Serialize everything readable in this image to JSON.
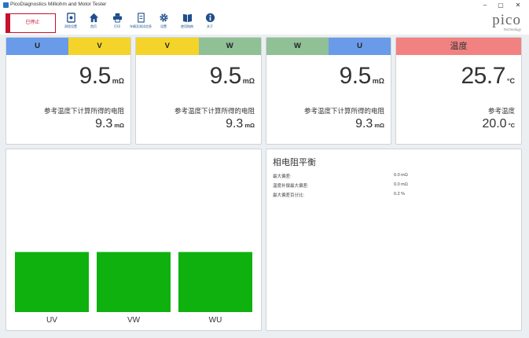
{
  "window": {
    "title": "PicoDiagnostics Milliohm and Motor Tester",
    "minimize": "–",
    "maximize": "▢",
    "close": "✕"
  },
  "toolbar": {
    "stop_label": "已停止",
    "tools": [
      {
        "icon": "sensor-settings-icon",
        "label": "测验设置"
      },
      {
        "icon": "home-icon",
        "label": "首页"
      },
      {
        "icon": "print-icon",
        "label": "打印"
      },
      {
        "icon": "report-icon",
        "label": "车辆及测试信息"
      },
      {
        "icon": "gear-icon",
        "label": "设置"
      },
      {
        "icon": "book-icon",
        "label": "使用指南"
      },
      {
        "icon": "info-icon",
        "label": "关于"
      }
    ],
    "logo_text": "pico",
    "logo_sub": "Technology"
  },
  "colors": {
    "U": "#6a9be8",
    "V": "#f4d42a",
    "W": "#90c095",
    "temp": "#f28282",
    "bar": "#0fb10f"
  },
  "cards": [
    {
      "head": [
        {
          "text": "U",
          "color": "#6a9be8"
        },
        {
          "text": "V",
          "color": "#f4d42a"
        }
      ],
      "value": "9.5",
      "unit": "mΩ",
      "sub_label": "参考温度下计算所得的电阻",
      "sub_value": "9.3",
      "sub_unit": "mΩ"
    },
    {
      "head": [
        {
          "text": "V",
          "color": "#f4d42a"
        },
        {
          "text": "W",
          "color": "#90c095"
        }
      ],
      "value": "9.5",
      "unit": "mΩ",
      "sub_label": "参考温度下计算所得的电阻",
      "sub_value": "9.3",
      "sub_unit": "mΩ"
    },
    {
      "head": [
        {
          "text": "W",
          "color": "#90c095"
        },
        {
          "text": "U",
          "color": "#6a9be8"
        }
      ],
      "value": "9.5",
      "unit": "mΩ",
      "sub_label": "参考温度下计算所得的电阻",
      "sub_value": "9.3",
      "sub_unit": "mΩ"
    },
    {
      "head": [
        {
          "text": "温度",
          "color": "#f28282"
        }
      ],
      "value": "25.7",
      "unit": "°C",
      "sub_label": "参考温度",
      "sub_value": "20.0",
      "sub_unit": "°C"
    }
  ],
  "chart_data": {
    "type": "bar",
    "categories": [
      "UV",
      "VW",
      "WU"
    ],
    "values": [
      9.5,
      9.5,
      9.5
    ],
    "unit": "mΩ",
    "ylim": [
      0,
      23
    ],
    "grid": false,
    "legend": "none"
  },
  "balance": {
    "title": "相电阻平衡",
    "rows": [
      {
        "label": "最大偏差:",
        "value": "0.0 mΩ"
      },
      {
        "label": "温度补偿最大偏差:",
        "value": "0.0 mΩ"
      },
      {
        "label": "最大偏差百分比:",
        "value": "0.2 %"
      }
    ]
  }
}
